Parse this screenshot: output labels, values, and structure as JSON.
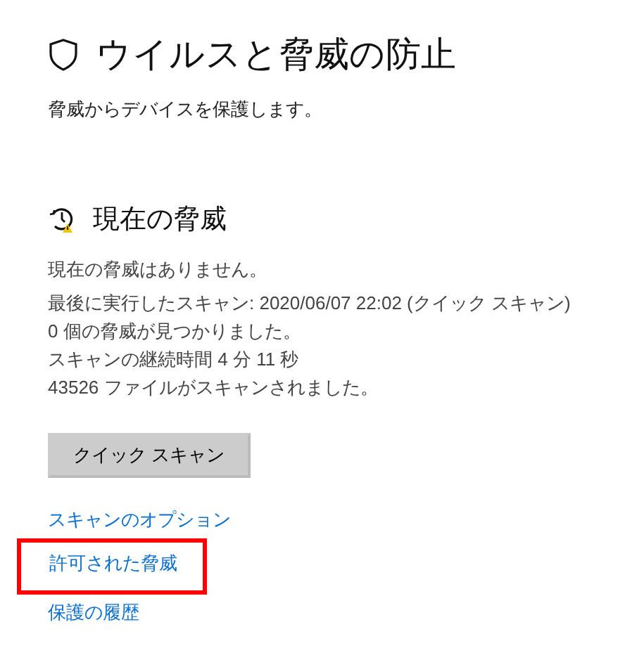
{
  "page_title": "ウイルスと脅威の防止",
  "subtitle": "脅威からデバイスを保護します。",
  "section": {
    "heading": "現在の脅威",
    "status": "現在の脅威はありません。",
    "details": [
      "最後に実行したスキャン: 2020/06/07 22:02 (クイック スキャン)",
      "0 個の脅威が見つかりました。",
      "スキャンの継続時間 4 分 11 秒",
      "43526 ファイルがスキャンされました。"
    ],
    "button": "クイック スキャン"
  },
  "links": [
    {
      "label": "スキャンのオプション",
      "highlighted": false
    },
    {
      "label": "許可された脅威",
      "highlighted": true
    },
    {
      "label": "保護の履歴",
      "highlighted": false
    }
  ]
}
